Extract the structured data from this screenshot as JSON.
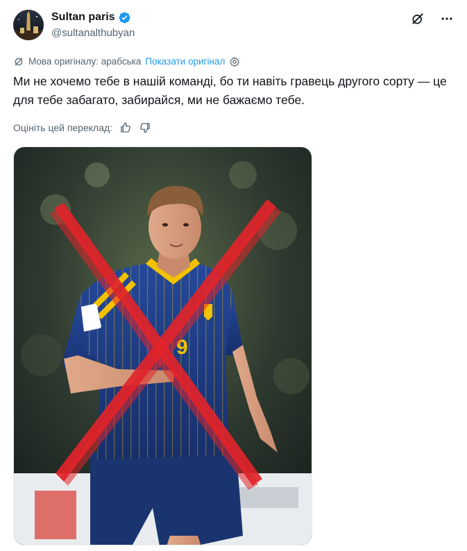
{
  "author": {
    "display_name": "Sultan paris",
    "handle": "@sultanalthubyan",
    "verified": true
  },
  "translation": {
    "language_label": "Мова оригіналу: арабська",
    "show_original_label": "Показати оригінал"
  },
  "tweet": {
    "text": "Ми не хочемо тебе в нашій команді, бо ти навіть гравець другого сорту — це для тебе забагато, забирайся, ми не бажаємо тебе."
  },
  "rating": {
    "label": "Оцініть цей переклад:"
  },
  "media": {
    "player_number": "9",
    "accent_colors": {
      "kit_blue": "#1f3f86",
      "kit_yellow": "#f2c200",
      "cross_red": "#e0242a"
    }
  },
  "colors": {
    "link": "#1d9bf0",
    "secondary_text": "#536471",
    "verified_badge": "#1d9bf0"
  },
  "icons": [
    "grok-icon",
    "more-icon",
    "translate-icon",
    "settings-icon",
    "thumbs-up-icon",
    "thumbs-down-icon",
    "verified-badge-icon"
  ]
}
